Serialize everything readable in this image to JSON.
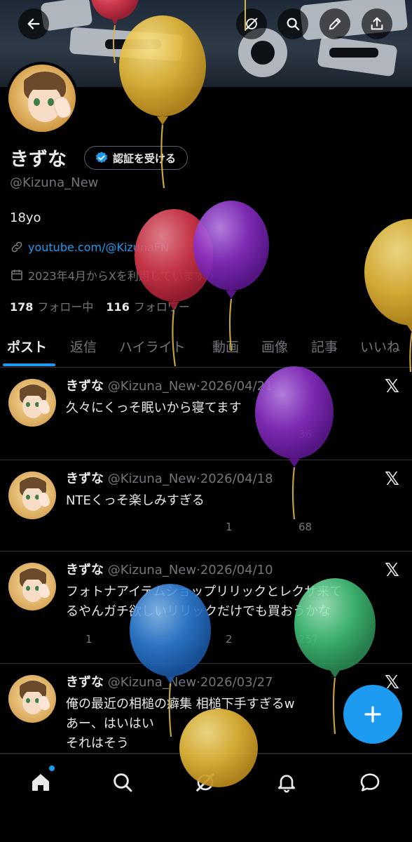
{
  "profile": {
    "display_name": "きずな",
    "verify_label": "認証を受ける",
    "handle": "@Kizuna_New",
    "bio": "18yo",
    "link": "youtube.com/@KizunaFN",
    "joined": "2023年4月からXを利用しています",
    "following_count": "178",
    "following_label": "フォロー中",
    "followers_count": "116",
    "followers_label": "フォロワー"
  },
  "tabs": [
    "ポスト",
    "返信",
    "ハイライト",
    "動画",
    "画像",
    "記事",
    "いいね"
  ],
  "posts": [
    {
      "name": "きずな",
      "handle": "@Kizuna_New",
      "date": "2026/04/21",
      "lines": [
        "久々にくっそ眠いから寝てます"
      ],
      "replies": "",
      "reposts": "",
      "likes": "",
      "views": "36"
    },
    {
      "name": "きずな",
      "handle": "@Kizuna_New",
      "date": "2026/04/18",
      "lines": [
        "NTEくっそ楽しみすぎる"
      ],
      "replies": "",
      "reposts": "",
      "likes": "1",
      "views": "68"
    },
    {
      "name": "きずな",
      "handle": "@Kizuna_New",
      "date": "2026/04/10",
      "lines": [
        "フォトナアイテムショップリリックとレクサ来て",
        "るやんガチ欲しいリリックだけでも買おうかな"
      ],
      "replies": "1",
      "reposts": "",
      "likes": "2",
      "views": "257"
    },
    {
      "name": "きずな",
      "handle": "@Kizuna_New",
      "date": "2026/03/27",
      "lines": [
        "俺の最近の相槌の癖集 相槌下手すぎるw",
        "あー、はいはい",
        "それはそう"
      ],
      "replies": "",
      "reposts": "",
      "likes": "",
      "views": ""
    }
  ],
  "colors": {
    "accent": "#1d9bf0",
    "muted": "#71767b",
    "text": "#e7e9ea",
    "background": "#000000",
    "balloon_gold": "#e2b73a",
    "balloon_red": "#d93b4f",
    "balloon_purple": "#8a2fc7",
    "balloon_blue": "#2f7fd6",
    "balloon_green": "#43c27a"
  },
  "icons": {
    "top": [
      "back-arrow-icon",
      "grok-icon",
      "search-icon",
      "edit-icon",
      "share-icon"
    ],
    "bottom_nav": [
      "home-icon",
      "search-icon",
      "grok-icon",
      "bell-icon",
      "messages-icon"
    ],
    "fab": "plus-icon"
  }
}
